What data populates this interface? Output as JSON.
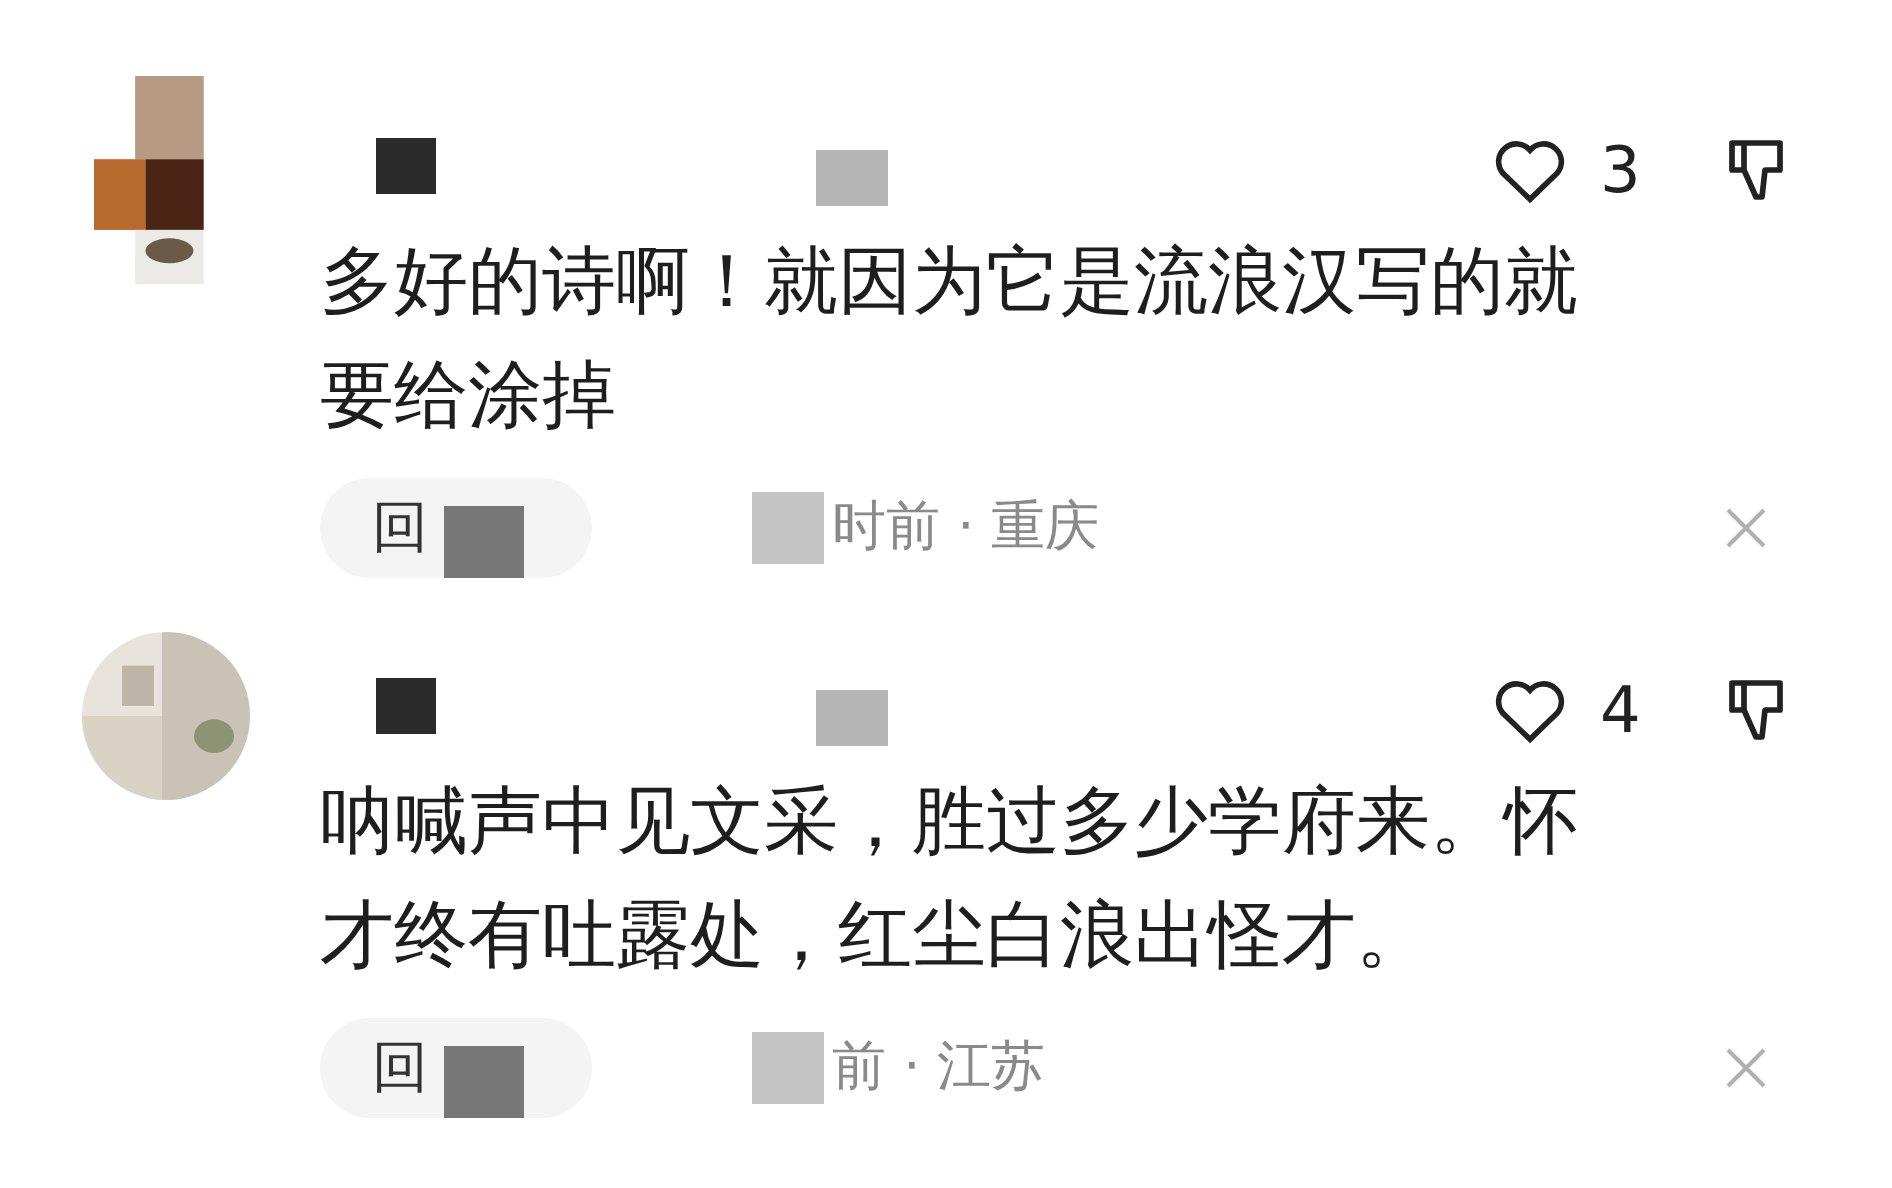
{
  "comments": [
    {
      "avatar": {
        "kind": "picture",
        "round": false
      },
      "likes": "3",
      "text": "多好的诗啊！就因为它是流浪汉写的就要给涂掉",
      "reply_label": "回",
      "meta": "时前 · 重庆"
    },
    {
      "avatar": {
        "kind": "picture",
        "round": true
      },
      "likes": "4",
      "text": "呐喊声中见文采，胜过多少学府来。怀才终有吐露处，红尘白浪出怪才。",
      "reply_label": "回",
      "meta": "前 · 江苏"
    }
  ]
}
